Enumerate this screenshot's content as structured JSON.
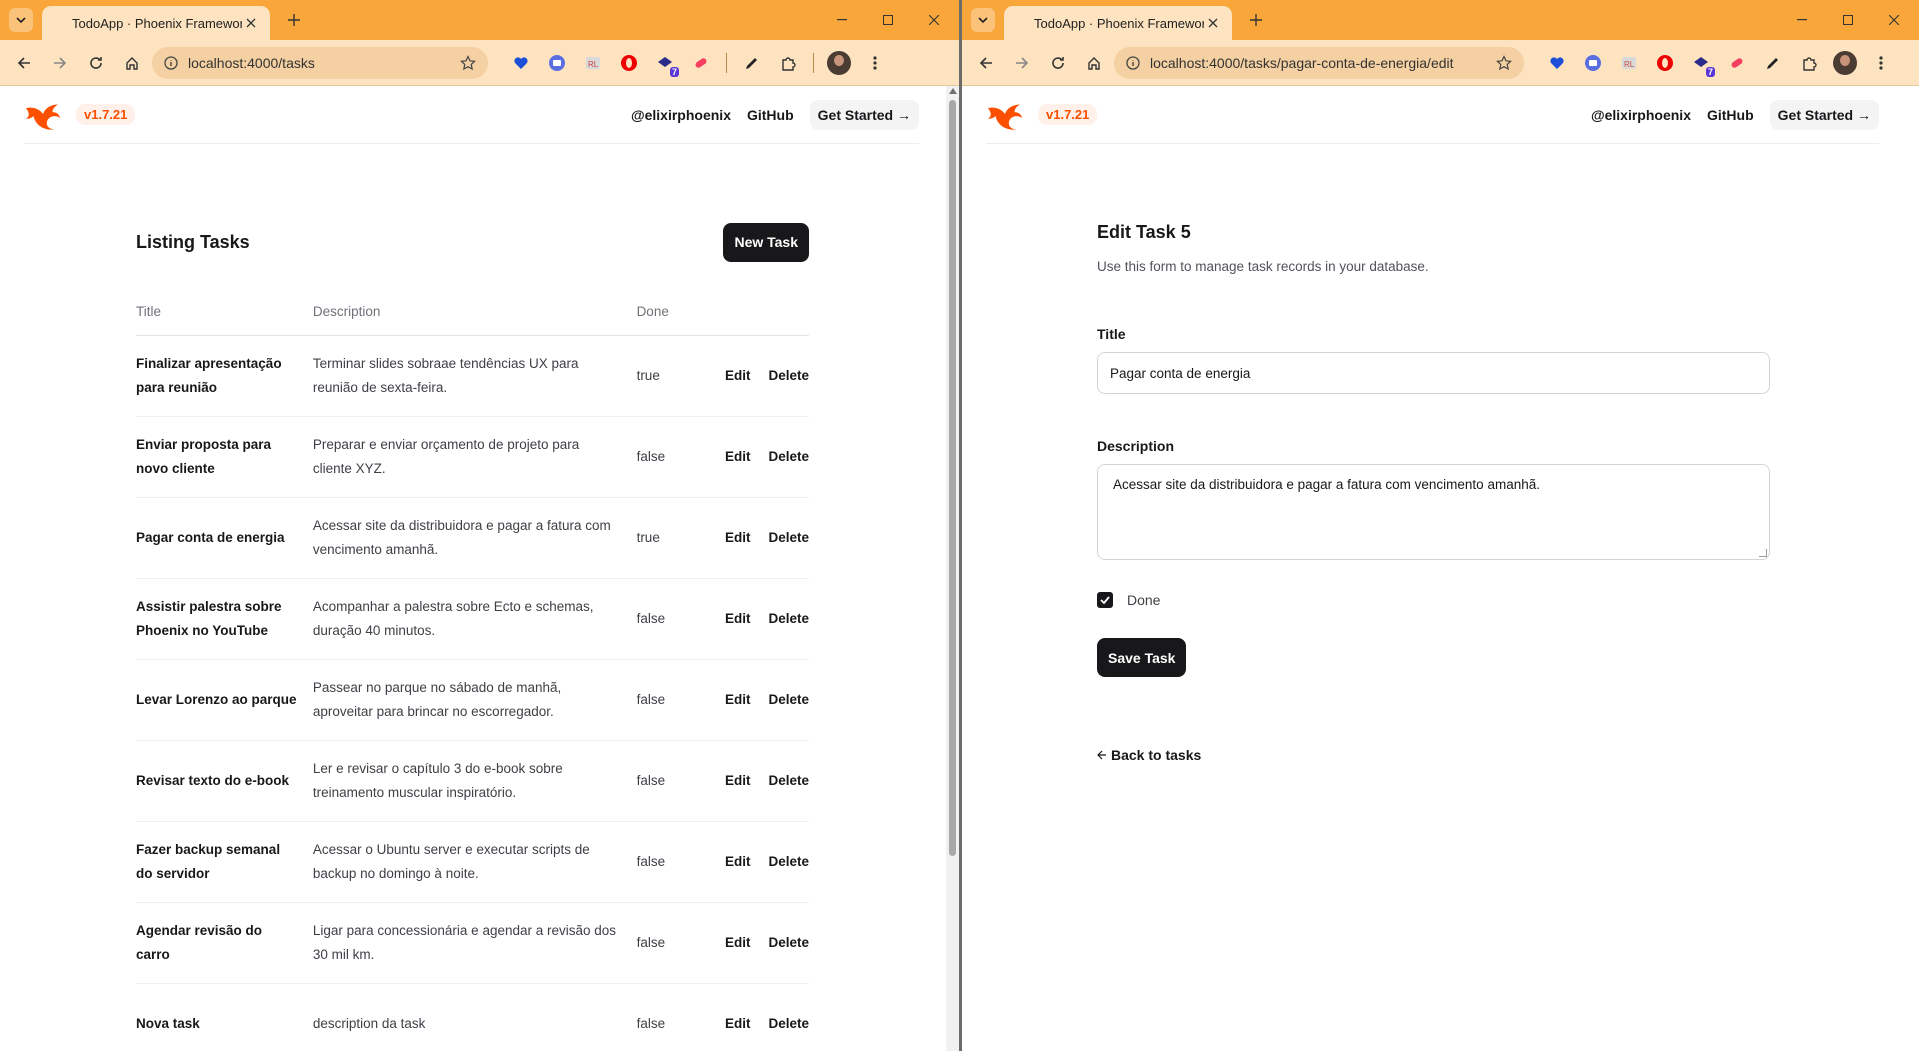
{
  "left": {
    "tab": {
      "title": "TodoApp · Phoenix Framework"
    },
    "url": "localhost:4000/tasks",
    "header": {
      "version": "v1.7.21",
      "links": [
        "@elixirphoenix",
        "GitHub",
        "Get Started →"
      ]
    },
    "listing": {
      "title": "Listing Tasks",
      "new_button": "New Task",
      "columns": [
        "Title",
        "Description",
        "Done"
      ],
      "rows": [
        {
          "title": "Finalizar apresentação para reunião",
          "description": "Terminar slides sobraae tendências UX para reunião de sexta-feira.",
          "done": "true"
        },
        {
          "title": "Enviar proposta para novo cliente",
          "description": "Preparar e enviar orçamento de projeto para cliente XYZ.",
          "done": "false"
        },
        {
          "title": "Pagar conta de energia",
          "description": "Acessar site da distribuidora e pagar a fatura com vencimento amanhã.",
          "done": "true"
        },
        {
          "title": "Assistir palestra sobre Phoenix no YouTube",
          "description": "Acompanhar a palestra sobre Ecto e schemas, duração 40 minutos.",
          "done": "false"
        },
        {
          "title": "Levar Lorenzo ao parque",
          "description": "Passear no parque no sábado de manhã, aproveitar para brincar no escorregador.",
          "done": "false"
        },
        {
          "title": "Revisar texto do e-book",
          "description": "Ler e revisar o capítulo 3 do e-book sobre treinamento muscular inspiratório.",
          "done": "false"
        },
        {
          "title": "Fazer backup semanal do servidor",
          "description": "Acessar o Ubuntu server e executar scripts de backup no domingo à noite.",
          "done": "false"
        },
        {
          "title": "Agendar revisão do carro",
          "description": "Ligar para concessionária e agendar a revisão dos 30 mil km.",
          "done": "false"
        },
        {
          "title": "Nova task",
          "description": "description da task",
          "done": "false"
        }
      ],
      "edit_label": "Edit",
      "delete_label": "Delete"
    }
  },
  "right": {
    "tab": {
      "title": "TodoApp · Phoenix Framework"
    },
    "url": "localhost:4000/tasks/pagar-conta-de-energia/edit",
    "header": {
      "version": "v1.7.21",
      "links": [
        "@elixirphoenix",
        "GitHub",
        "Get Started →"
      ]
    },
    "form": {
      "title": "Edit Task 5",
      "subtitle": "Use this form to manage task records in your database.",
      "title_label": "Title",
      "title_value": "Pagar conta de energia",
      "description_label": "Description",
      "description_value": "Acessar site da distribuidora e pagar a fatura com vencimento amanhã.",
      "done_label": "Done",
      "done_checked": true,
      "save_button": "Save Task",
      "back_link": "Back to tasks"
    }
  },
  "colors": {
    "tabstrip": "#f9a63b",
    "toolbar": "#fde3bf",
    "phoenix": "#fd4f00",
    "dark": "#18181b"
  },
  "extensions": [
    "heart-shield-icon",
    "translate-icon",
    "grammar-icon",
    "opera-icon",
    "stack-icon",
    "pill-icon",
    "pen-icon",
    "puzzle-icon"
  ]
}
